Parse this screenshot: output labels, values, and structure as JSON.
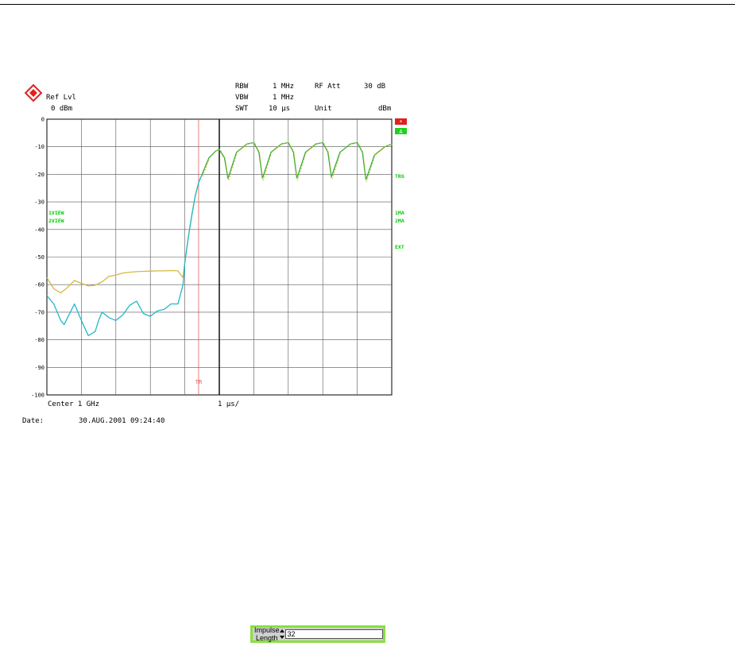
{
  "header": {
    "ref_lvl_label": "Ref Lvl",
    "ref_lvl_value": "0 dBm",
    "rbw_label": "RBW",
    "rbw_value": "1 MHz",
    "vbw_label": "VBW",
    "vbw_value": "1 MHz",
    "swt_label": "SWT",
    "swt_value": "10 µs",
    "rfatt_label": "RF Att",
    "rfatt_value": "30 dB",
    "unit_label": "Unit",
    "unit_value": "dBm"
  },
  "side_labels": {
    "trace1": "1VIEW",
    "trace2": "2VIEW",
    "right_trg": "TRG",
    "right_1ma": "1MA",
    "right_2ma": "2MA",
    "right_ext": "EXT",
    "marker_a": "*",
    "marker_b": "A"
  },
  "footer": {
    "center": "Center 1 GHz",
    "span": "1 µs/",
    "date_label": "Date:",
    "date_value": "30.AUG.2001  09:24:40"
  },
  "widget": {
    "label": "Impulse Length",
    "value": "32"
  },
  "colors": {
    "trace_yellow": "#d4b840",
    "trace_cyan": "#20b8c8",
    "trace_green": "#30b030",
    "trigger_line": "#e06060",
    "logo": "#e02020"
  },
  "chart_data": {
    "type": "line",
    "title": "",
    "xlabel": "1 µs/",
    "ylabel": "dBm",
    "xlim": [
      0,
      10
    ],
    "ylim": [
      -100,
      0
    ],
    "y_ticks": [
      0,
      -10,
      -20,
      -30,
      -40,
      -50,
      -60,
      -70,
      -80,
      -90,
      -100
    ],
    "grid": true,
    "trigger_label": "TR",
    "trigger_x": 4.4,
    "center_x": 5.0,
    "series": [
      {
        "color": "#d4b840",
        "x": [
          0,
          0.2,
          0.4,
          0.6,
          0.8,
          1.0,
          1.2,
          1.4,
          1.6,
          1.8,
          2.0,
          2.2,
          2.4,
          2.6,
          2.8,
          3.0,
          3.2,
          3.4,
          3.6,
          3.8,
          3.95,
          4.0,
          4.1,
          4.2,
          4.3,
          4.4,
          4.5
        ],
        "y": [
          -57.5,
          -61.5,
          -63,
          -61,
          -58.5,
          -59.5,
          -60.5,
          -60.2,
          -59,
          -57,
          -56.5,
          -55.8,
          -55.5,
          -55.3,
          -55.2,
          -55.1,
          -55,
          -55,
          -54.9,
          -55,
          -57.5,
          -52,
          -43,
          -35,
          -28,
          -23,
          -20
        ]
      },
      {
        "color": "#20b8c8",
        "x": [
          0,
          0.2,
          0.4,
          0.5,
          0.6,
          0.8,
          1.0,
          1.2,
          1.4,
          1.5,
          1.6,
          1.8,
          2.0,
          2.2,
          2.4,
          2.6,
          2.8,
          3.0,
          3.2,
          3.4,
          3.6,
          3.8,
          3.95,
          4.0,
          4.1,
          4.2,
          4.3,
          4.4,
          4.5
        ],
        "y": [
          -64,
          -67,
          -73,
          -74.5,
          -72,
          -67,
          -73,
          -78.5,
          -77,
          -73,
          -70,
          -72,
          -73,
          -71,
          -67.5,
          -66,
          -70.5,
          -71.5,
          -69.5,
          -69,
          -67,
          -67,
          -60,
          -52,
          -43,
          -35,
          -28,
          -23,
          -20
        ]
      },
      {
        "color": "#30b030",
        "x": [
          4.5,
          4.7,
          4.9,
          5.0,
          5.15,
          5.25,
          5.5,
          5.8,
          6.0,
          6.15,
          6.25,
          6.5,
          6.8,
          7.0,
          7.15,
          7.25,
          7.5,
          7.8,
          8.0,
          8.15,
          8.25,
          8.5,
          8.8,
          9.0,
          9.15,
          9.25,
          9.5,
          9.8,
          10.0
        ],
        "y": [
          -20,
          -14,
          -11.5,
          -11,
          -14,
          -21.5,
          -12,
          -9,
          -8.5,
          -12,
          -21.5,
          -12,
          -9,
          -8.5,
          -12,
          -21.5,
          -12,
          -9,
          -8.5,
          -12,
          -21,
          -12,
          -9,
          -8.5,
          -12,
          -22,
          -13,
          -10,
          -9
        ]
      }
    ]
  }
}
